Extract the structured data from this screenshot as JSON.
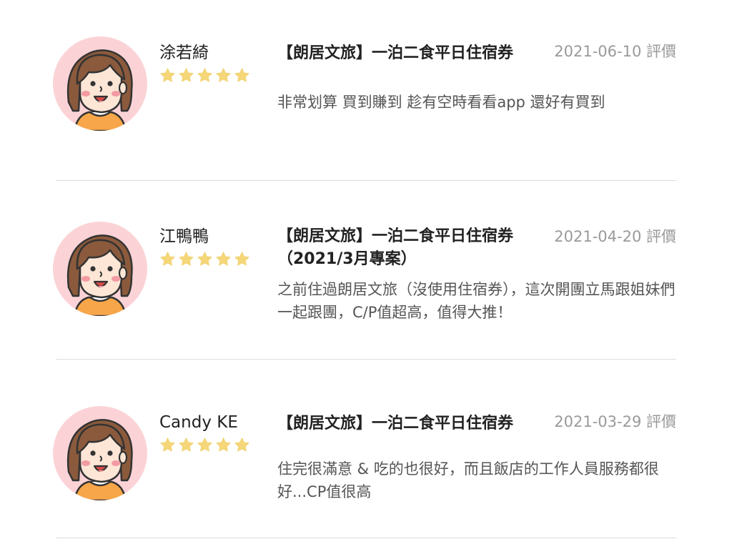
{
  "reviews": [
    {
      "name": "涂若綺",
      "rating": 5,
      "product": "【朗居文旅】一泊二食平日住宿券",
      "date": "2021-06-10 評價",
      "comment": "非常划算 買到賺到 趁有空時看看app 還好有買到"
    },
    {
      "name": "江鴨鴨",
      "rating": 5,
      "product": "【朗居文旅】一泊二食平日住宿券（2021/3月專案）",
      "date": "2021-04-20 評價",
      "comment": "之前住過朗居文旅（沒使用住宿券），這次開團立馬跟姐妹們一起跟團，C/P值超高，值得大推！"
    },
    {
      "name": "Candy KE",
      "rating": 5,
      "product": "【朗居文旅】一泊二食平日住宿券",
      "date": "2021-03-29 評價",
      "comment": "住完很滿意 & 吃的也很好，而且飯店的工作人員服務都很好...CP值很高"
    }
  ],
  "colors": {
    "star": "#f5d77a",
    "avatar_bg": "#fbd3d6",
    "hair": "#8b5a3c",
    "divider": "#dcdcdc",
    "date": "#9a9a9a",
    "comment": "#555555"
  },
  "icons": {
    "avatar": "girl-avatar-icon",
    "star": "star-icon"
  }
}
